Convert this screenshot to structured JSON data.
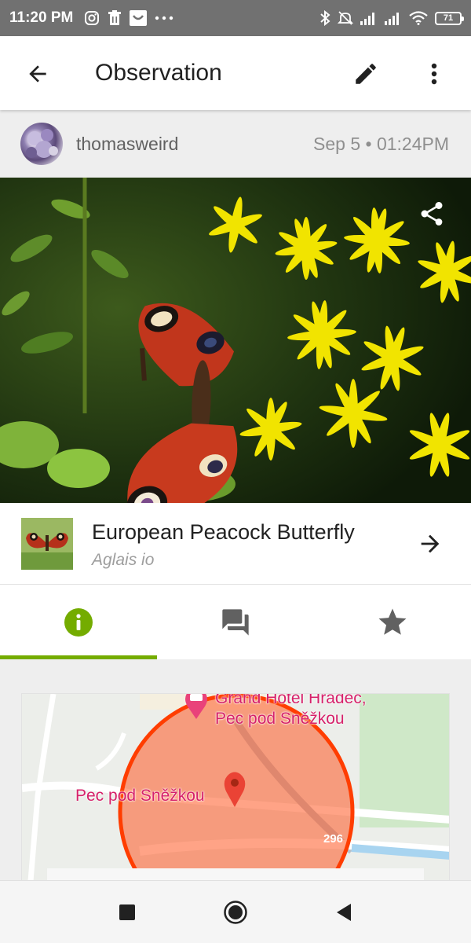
{
  "status_bar": {
    "time": "11:20 PM",
    "battery": "71",
    "left_icons": [
      "instagram-icon",
      "trash-icon",
      "inbox-icon",
      "more-dots-icon"
    ],
    "right_icons": [
      "bluetooth-icon",
      "mute-icon",
      "signal-icon",
      "signal-icon",
      "wifi-icon",
      "battery-icon"
    ]
  },
  "app_bar": {
    "title": "Observation",
    "back_icon": "arrow-back-icon",
    "edit_icon": "pencil-icon",
    "menu_icon": "more-vert-icon"
  },
  "observer": {
    "username": "thomasweird",
    "date": "Sep 5 • 01:24PM"
  },
  "photo": {
    "share_icon": "share-icon"
  },
  "species": {
    "common_name": "European Peacock Butterfly",
    "scientific_name": "Aglais io"
  },
  "tabs": [
    {
      "icon": "info-icon",
      "active": true
    },
    {
      "icon": "comments-icon",
      "active": false
    },
    {
      "icon": "star-icon",
      "active": false
    }
  ],
  "map": {
    "poi_label": "Grand Hotel Hradec,\nPec pod Sněžkou",
    "poi_label_line1": "Grand Hotel Hradec,",
    "poi_label_line2": "Pec pod Sněžkou",
    "place_label": "Pec pod Sněžkou",
    "road_number": "296"
  },
  "colors": {
    "accent": "#74ac00",
    "accuracy_circle": "#ff5722",
    "status_bar": "#717171"
  }
}
